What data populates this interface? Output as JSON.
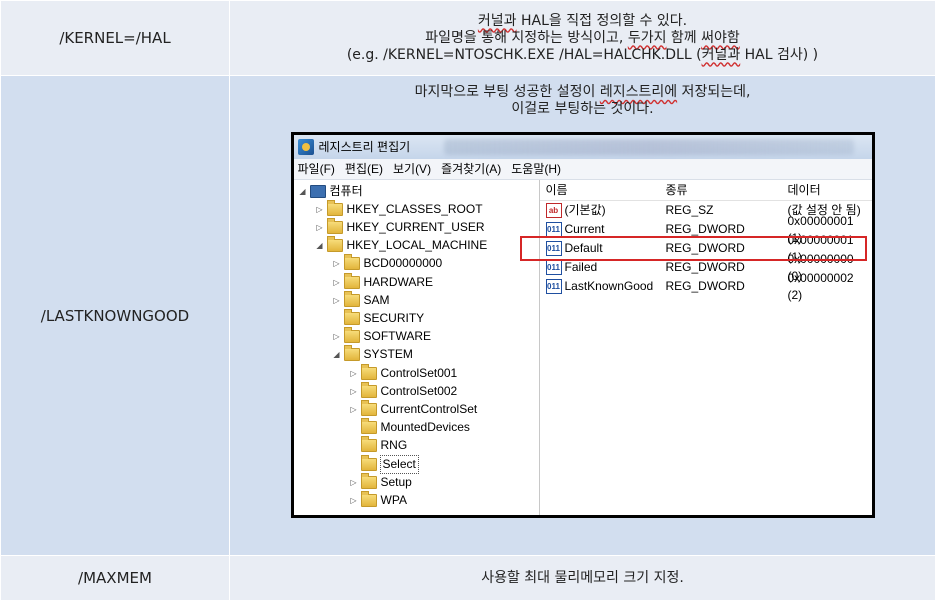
{
  "rows": [
    {
      "key": "/KERNEL=/HAL",
      "desc": {
        "line1_a": "커널과",
        "line1_b": " HAL을 직접 정의할 수 있다.",
        "line2_a": "파일명을 통해 지정하는 방식이고, ",
        "line2_b": "두가지",
        "line2_c": " 함께 ",
        "line2_d": "써야함",
        "line3_a": "(e.g. /KERNEL=NTOSCHK.EXE /HAL=HALCHK.DLL (",
        "line3_b": "커널과",
        "line3_c": " HAL 검사) )"
      }
    },
    {
      "key": "/LASTKNOWNGOOD",
      "desc": {
        "line1_a": "마지막으로 부팅 성공한 설정이 ",
        "line1_b": "레지스트리에",
        "line1_c": " 저장되는데,",
        "line2": "이걸로 부팅하는 것이다."
      }
    },
    {
      "key": "/MAXMEM",
      "desc": {
        "line1": "사용할 최대 물리메모리 크기 지정."
      }
    }
  ],
  "regedit": {
    "title": "레지스트리 편집기",
    "menu": [
      "파일(F)",
      "편집(E)",
      "보기(V)",
      "즐겨찾기(A)",
      "도움말(H)"
    ],
    "tree": [
      {
        "label": "컴퓨터",
        "icon": "computer-icon",
        "expander": "◢"
      },
      {
        "label": "HKEY_CLASSES_ROOT",
        "icon": "folder-icon",
        "expander": "▷"
      },
      {
        "label": "HKEY_CURRENT_USER",
        "icon": "folder-icon",
        "expander": "▷"
      },
      {
        "label": "HKEY_LOCAL_MACHINE",
        "icon": "folder-icon",
        "expander": "◢"
      },
      {
        "label": "BCD00000000",
        "icon": "folder-icon",
        "expander": "▷"
      },
      {
        "label": "HARDWARE",
        "icon": "folder-icon",
        "expander": "▷"
      },
      {
        "label": "SAM",
        "icon": "folder-icon",
        "expander": "▷"
      },
      {
        "label": "SECURITY",
        "icon": "folder-icon",
        "expander": ""
      },
      {
        "label": "SOFTWARE",
        "icon": "folder-icon",
        "expander": "▷"
      },
      {
        "label": "SYSTEM",
        "icon": "folder-icon",
        "expander": "◢"
      },
      {
        "label": "ControlSet001",
        "icon": "folder-icon",
        "expander": "▷"
      },
      {
        "label": "ControlSet002",
        "icon": "folder-icon",
        "expander": "▷"
      },
      {
        "label": "CurrentControlSet",
        "icon": "folder-icon",
        "expander": "▷"
      },
      {
        "label": "MountedDevices",
        "icon": "folder-icon",
        "expander": ""
      },
      {
        "label": "RNG",
        "icon": "folder-icon",
        "expander": ""
      },
      {
        "label": "Select",
        "icon": "folder-icon",
        "expander": ""
      },
      {
        "label": "Setup",
        "icon": "folder-icon",
        "expander": "▷"
      },
      {
        "label": "WPA",
        "icon": "folder-icon",
        "expander": "▷"
      }
    ],
    "columns": [
      "이름",
      "종류",
      "데이터"
    ],
    "values": [
      {
        "name": "(기본값)",
        "type": "REG_SZ",
        "data": "(값 설정 안 됨)",
        "icon": "string-value-icon",
        "glyph": "ab"
      },
      {
        "name": "Current",
        "type": "REG_DWORD",
        "data": "0x00000001 (1)",
        "icon": "binary-value-icon",
        "glyph": "011"
      },
      {
        "name": "Default",
        "type": "REG_DWORD",
        "data": "0x00000001 (1)",
        "icon": "binary-value-icon",
        "glyph": "011"
      },
      {
        "name": "Failed",
        "type": "REG_DWORD",
        "data": "0x00000000 (0)",
        "icon": "binary-value-icon",
        "glyph": "011"
      },
      {
        "name": "LastKnownGood",
        "type": "REG_DWORD",
        "data": "0x00000002 (2)",
        "icon": "binary-value-icon",
        "glyph": "011"
      }
    ],
    "highlight_color": "#d62626"
  }
}
